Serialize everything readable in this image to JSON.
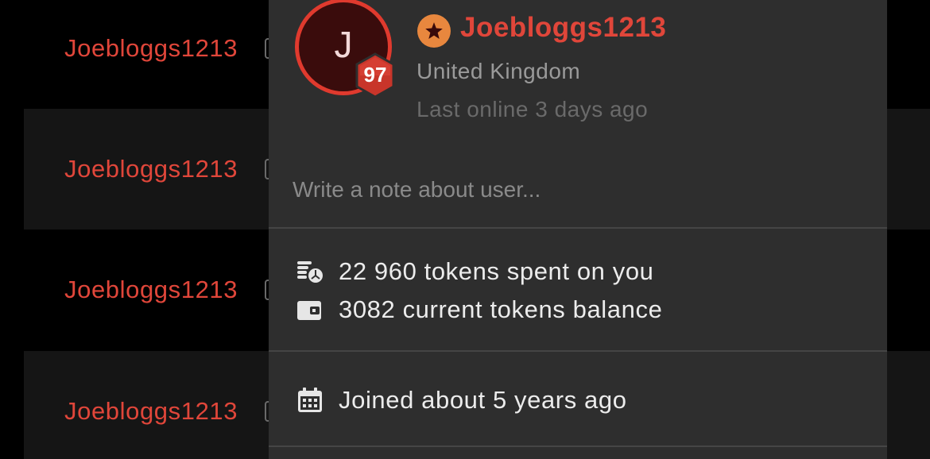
{
  "background_list": {
    "rows": [
      {
        "username": "Joebloggs1213"
      },
      {
        "username": "Joebloggs1213"
      },
      {
        "username": "Joebloggs1213"
      },
      {
        "username": "Joebloggs1213"
      }
    ]
  },
  "profile_card": {
    "avatar_initial": "J",
    "level": "97",
    "username": "Joebloggs1213",
    "country": "United Kingdom",
    "last_online": "Last online 3 days ago",
    "note_placeholder": "Write a note about user...",
    "stats": {
      "tokens_spent": "22 960 tokens spent on you",
      "tokens_balance": "3082 current tokens balance"
    },
    "joined": "Joined about 5 years ago"
  },
  "colors": {
    "accent": "#e0463a",
    "badge_orange": "#e8873e",
    "card_bg": "#2e2e2e"
  },
  "icons": [
    "star-icon",
    "coins-icon",
    "wallet-icon",
    "calendar-icon"
  ]
}
